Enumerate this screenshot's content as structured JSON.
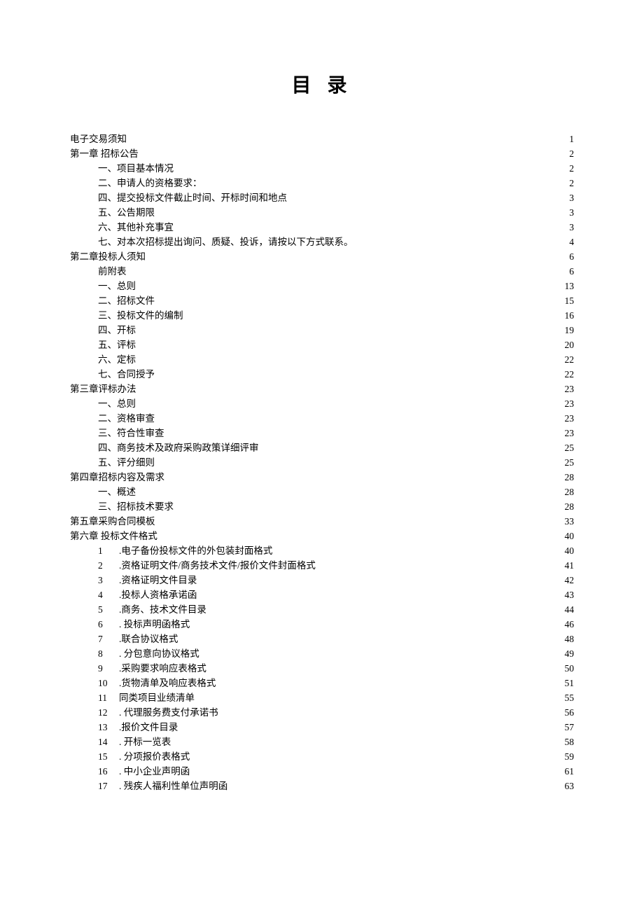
{
  "title": "目 录",
  "toc": [
    {
      "indent": 0,
      "num": "",
      "label": "电子交易须知",
      "page": "1"
    },
    {
      "indent": 0,
      "num": "",
      "label": "第一章  招标公告",
      "page": "2"
    },
    {
      "indent": 1,
      "num": "",
      "label": "一、项目基本情况",
      "page": "2"
    },
    {
      "indent": 1,
      "num": "",
      "label": "二、申请人的资格要求：",
      "page": "2"
    },
    {
      "indent": 1,
      "num": "",
      "label": "四、提交投标文件截止时间、开标时间和地点",
      "page": "3"
    },
    {
      "indent": 1,
      "num": "",
      "label": "五、公告期限",
      "page": "3"
    },
    {
      "indent": 1,
      "num": "",
      "label": "六、其他补充事宜",
      "page": "3"
    },
    {
      "indent": 1,
      "num": "",
      "label": "七、对本次招标提出询问、质疑、投诉，请按以下方式联系。",
      "page": "4"
    },
    {
      "indent": 0,
      "num": "",
      "label": "第二章投标人须知",
      "page": "6"
    },
    {
      "indent": 1,
      "num": "",
      "label": "前附表",
      "page": "6"
    },
    {
      "indent": 1,
      "num": "",
      "label": "一、总则",
      "page": "13"
    },
    {
      "indent": 1,
      "num": "",
      "label": "二、招标文件",
      "page": "15"
    },
    {
      "indent": 1,
      "num": "",
      "label": "三、投标文件的编制",
      "page": "16"
    },
    {
      "indent": 1,
      "num": "",
      "label": "四、开标",
      "page": "19"
    },
    {
      "indent": 1,
      "num": "",
      "label": "五、评标",
      "page": "20"
    },
    {
      "indent": 1,
      "num": "",
      "label": "六、定标",
      "page": "22"
    },
    {
      "indent": 1,
      "num": "",
      "label": "七、合同授予",
      "page": "22"
    },
    {
      "indent": 0,
      "num": "",
      "label": "第三章评标办法",
      "page": "23"
    },
    {
      "indent": 1,
      "num": "",
      "label": "一、总则",
      "page": "23"
    },
    {
      "indent": 1,
      "num": "",
      "label": "二、资格审查",
      "page": "23"
    },
    {
      "indent": 1,
      "num": "",
      "label": "三、符合性审查",
      "page": "23"
    },
    {
      "indent": 1,
      "num": "",
      "label": "四、商务技术及政府采购政策详细评审",
      "page": "25"
    },
    {
      "indent": 1,
      "num": "",
      "label": "五、评分细则",
      "page": "25"
    },
    {
      "indent": 0,
      "num": "",
      "label": "第四章招标内容及需求",
      "page": "28"
    },
    {
      "indent": 1,
      "num": "",
      "label": "一、概述",
      "page": "28"
    },
    {
      "indent": 1,
      "num": "",
      "label": "三、招标技术要求",
      "page": "28"
    },
    {
      "indent": 0,
      "num": "",
      "label": "第五章采购合同模板",
      "page": "33"
    },
    {
      "indent": 0,
      "num": "",
      "label": "第六章  投标文件格式",
      "page": "40"
    },
    {
      "indent": 2,
      "num": "1",
      "label": ".电子备份投标文件的外包装封面格式",
      "page": "40"
    },
    {
      "indent": 2,
      "num": "2",
      "label": ".资格证明文件/商务技术文件/报价文件封面格式",
      "page": "41"
    },
    {
      "indent": 2,
      "num": "3",
      "label": ".资格证明文件目录",
      "page": "42"
    },
    {
      "indent": 2,
      "num": "4",
      "label": ".投标人资格承诺函",
      "page": "43"
    },
    {
      "indent": 2,
      "num": "5",
      "label": ".商务、技术文件目录",
      "page": "44"
    },
    {
      "indent": 2,
      "num": "6",
      "label": ". 投标声明函格式",
      "page": "46"
    },
    {
      "indent": 2,
      "num": "7",
      "label": ".联合协议格式",
      "page": "48"
    },
    {
      "indent": 2,
      "num": "8",
      "label": ". 分包意向协议格式",
      "page": "49"
    },
    {
      "indent": 2,
      "num": "9",
      "label": ".采购要求响应表格式",
      "page": "50"
    },
    {
      "indent": 2,
      "num": "10",
      "label": ".货物清单及响应表格式",
      "page": "51"
    },
    {
      "indent": 2,
      "num": "11",
      "label": "  同类项目业绩清单",
      "page": "55"
    },
    {
      "indent": 2,
      "num": "12",
      "label": ". 代理服务费支付承诺书",
      "page": "56"
    },
    {
      "indent": 2,
      "num": "13",
      "label": ".报价文件目录",
      "page": "57"
    },
    {
      "indent": 2,
      "num": "14",
      "label": ". 开标一览表",
      "page": "58"
    },
    {
      "indent": 2,
      "num": "15",
      "label": ". 分项报价表格式",
      "page": "59"
    },
    {
      "indent": 2,
      "num": "16",
      "label": ". 中小企业声明函",
      "page": "61"
    },
    {
      "indent": 2,
      "num": "17",
      "label": ". 残疾人福利性单位声明函",
      "page": "63"
    }
  ]
}
